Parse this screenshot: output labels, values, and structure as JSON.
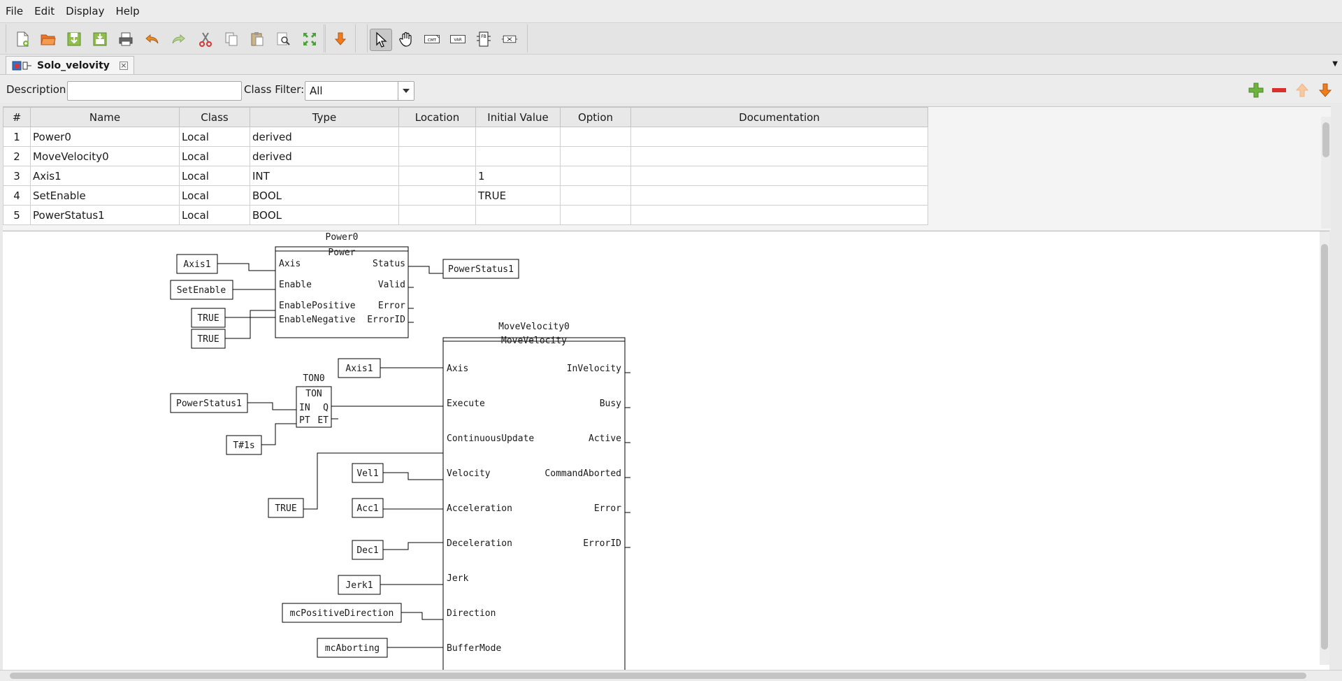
{
  "menu": [
    "File",
    "Edit",
    "Display",
    "Help"
  ],
  "toolbar_icons": [
    "new-file-icon",
    "open-icon",
    "save-icon",
    "save-as-icon",
    "print-icon",
    "undo-icon",
    "redo-icon",
    "cut-icon",
    "copy-icon",
    "paste-icon",
    "search-icon",
    "zoom-fit-icon",
    "transfer-icon",
    "pointer-icon",
    "hand-icon",
    "comment-icon",
    "variable-icon",
    "function-block-icon",
    "connection-icon"
  ],
  "toolbar_labels": {
    "comment": "CMT",
    "variable": "VAR",
    "fb": "FB"
  },
  "tab": {
    "title": "Solo_velovity"
  },
  "filter": {
    "description_label": "Description:",
    "description_value": "",
    "class_filter_label": "Class Filter:",
    "class_filter_value": "All"
  },
  "table": {
    "headers": [
      "#",
      "Name",
      "Class",
      "Type",
      "Location",
      "Initial Value",
      "Option",
      "Documentation"
    ],
    "rows": [
      {
        "num": "1",
        "name": "Power0",
        "class": "Local",
        "type": "derived",
        "location": "",
        "initial": "",
        "option": "",
        "doc": ""
      },
      {
        "num": "2",
        "name": "MoveVelocity0",
        "class": "Local",
        "type": "derived",
        "location": "",
        "initial": "",
        "option": "",
        "doc": ""
      },
      {
        "num": "3",
        "name": "Axis1",
        "class": "Local",
        "type": "INT",
        "location": "",
        "initial": "1",
        "option": "",
        "doc": ""
      },
      {
        "num": "4",
        "name": "SetEnable",
        "class": "Local",
        "type": "BOOL",
        "location": "",
        "initial": "TRUE",
        "option": "",
        "doc": ""
      },
      {
        "num": "5",
        "name": "PowerStatus1",
        "class": "Local",
        "type": "BOOL",
        "location": "",
        "initial": "",
        "option": "",
        "doc": ""
      }
    ]
  },
  "diagram": {
    "power": {
      "instance": "Power0",
      "type": "Power",
      "inputs": [
        "Axis",
        "Enable",
        "EnablePositive",
        "EnableNegative"
      ],
      "outputs": [
        "Status",
        "Valid",
        "Error",
        "ErrorID"
      ]
    },
    "power_vars": {
      "axis": "Axis1",
      "enable": "SetEnable",
      "pos": "TRUE",
      "neg": "TRUE",
      "status": "PowerStatus1"
    },
    "ton": {
      "instance": "TON0",
      "type": "TON",
      "in": "IN",
      "q": "Q",
      "pt": "PT",
      "et": "ET"
    },
    "ton_vars": {
      "in": "PowerStatus1",
      "pt": "T#1s"
    },
    "mv": {
      "instance": "MoveVelocity0",
      "type": "MoveVelocity",
      "inputs": [
        "Axis",
        "Execute",
        "ContinuousUpdate",
        "Velocity",
        "Acceleration",
        "Deceleration",
        "Jerk",
        "Direction",
        "BufferMode"
      ],
      "outputs": [
        "InVelocity",
        "Busy",
        "Active",
        "CommandAborted",
        "Error",
        "ErrorID"
      ]
    },
    "mv_vars": {
      "axis": "Axis1",
      "cont": "TRUE",
      "vel": "Vel1",
      "acc": "Acc1",
      "dec": "Dec1",
      "jerk": "Jerk1",
      "dir": "mcPositiveDirection",
      "buf": "mcAborting"
    }
  }
}
